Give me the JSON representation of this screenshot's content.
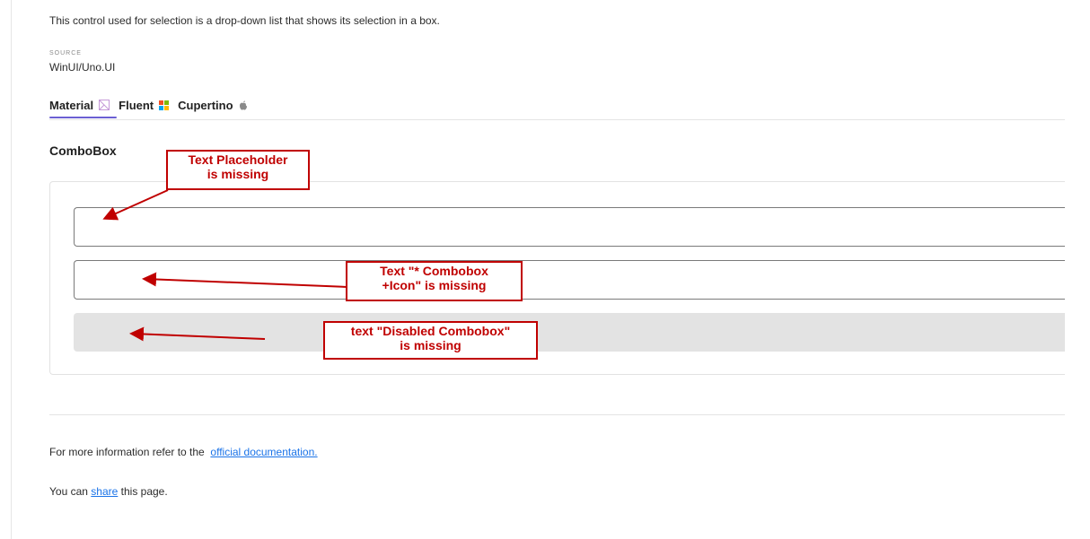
{
  "intro": "This control used for selection is a drop-down list that shows its selection in a box.",
  "source": {
    "label": "SOURCE",
    "value": "WinUI/Uno.UI"
  },
  "tabs": [
    {
      "label": "Material",
      "icon": "material-icon",
      "selected": true
    },
    {
      "label": "Fluent",
      "icon": "fluent-icon",
      "selected": false
    },
    {
      "label": "Cupertino",
      "icon": "apple-icon",
      "selected": false
    }
  ],
  "section_title": "ComboBox",
  "comboboxes": [
    {
      "state": "default",
      "value": "",
      "placeholder": ""
    },
    {
      "state": "required",
      "value": "",
      "placeholder": ""
    },
    {
      "state": "disabled",
      "value": "",
      "placeholder": ""
    }
  ],
  "annotations": [
    {
      "lines": [
        "Text Placeholder",
        "is missing"
      ]
    },
    {
      "lines": [
        "Text \"* Combobox",
        "+Icon\" is missing"
      ]
    },
    {
      "lines": [
        "text \"Disabled Combobox\"",
        "is missing"
      ]
    }
  ],
  "footer": {
    "more_info_prefix": "For more information refer to the",
    "doc_link": "official documentation.",
    "share_prefix": "You can",
    "share_link": "share",
    "share_suffix": "this page."
  },
  "colors": {
    "accent": "#6b5fd3",
    "link": "#1a73e8",
    "annotation": "#c00000",
    "disabled_fill": "#e3e3e3"
  }
}
